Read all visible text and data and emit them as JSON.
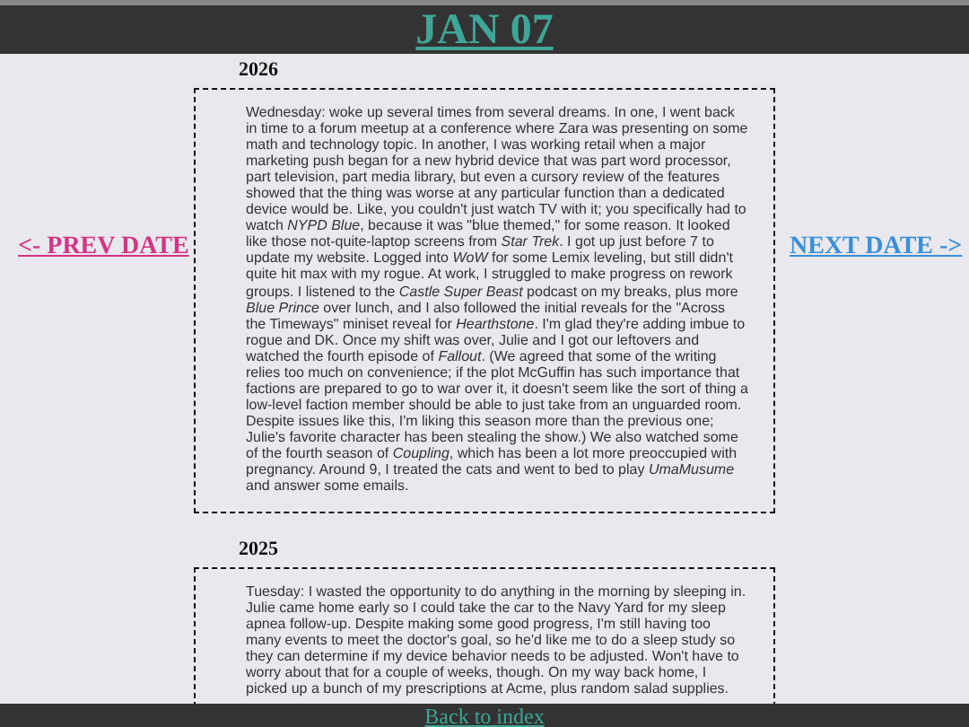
{
  "header": {
    "title": "JAN 07"
  },
  "nav": {
    "prev": "<- PREV DATE",
    "next": "NEXT DATE ->"
  },
  "entries": [
    {
      "year": "2026",
      "text": "Wednesday: woke up several times from several dreams. In one, I went back in time to a forum meetup at a conference where Zara was presenting on some math and technology topic. In another, I was working retail when a major marketing push began for a new hybrid device that was part word processor, part television, part media library, but even a cursory review of the features showed that the thing was worse at any particular function than a dedicated device would be. Like, you couldn't just watch TV with it; you specifically had to watch *NYPD Blue*, because it was \"blue themed,\" for some reason. It looked like those not-quite-laptop screens from *Star Trek*. I got up just before 7 to update my website. Logged into *WoW* for some Lemix leveling, but still didn't quite hit max with my rogue. At work, I struggled to make progress on rework groups. I listened to the *Castle Super Beast* podcast on my breaks, plus more *Blue Prince* over lunch, and I also followed the initial reveals for the \"Across the Timeways\" miniset reveal for *Hearthstone*. I'm glad they're adding imbue to rogue and DK. Once my shift was over, Julie and I got our leftovers and watched the fourth episode of *Fallout*. (We agreed that some of the writing relies too much on convenience; if the plot McGuffin has such importance that factions are prepared to go to war over it, it doesn't seem like the sort of thing a low-level faction member should be able to just take from an unguarded room. Despite issues like this, I'm liking this season more than the previous one; Julie's favorite character has been stealing the show.) We also watched some of the fourth season of *Coupling*, which has been a lot more preoccupied with pregnancy. Around 9, I treated the cats and went to bed to play *UmaMusume* and answer some emails."
    },
    {
      "year": "2025",
      "text": "Tuesday: I wasted the opportunity to do anything in the morning by sleeping in. Julie came home early so I could take the car to the Navy Yard for my sleep apnea follow-up. Despite making some good progress, I'm still having too many events to meet the doctor's goal, so he'd like me to do a sleep study so they can determine if my device behavior needs to be adjusted. Won't have to worry about that for a couple of weeks, though. On my way back home, I picked up a bunch of my prescriptions at Acme, plus random salad supplies."
    }
  ],
  "footer": {
    "link": "Back to index"
  }
}
